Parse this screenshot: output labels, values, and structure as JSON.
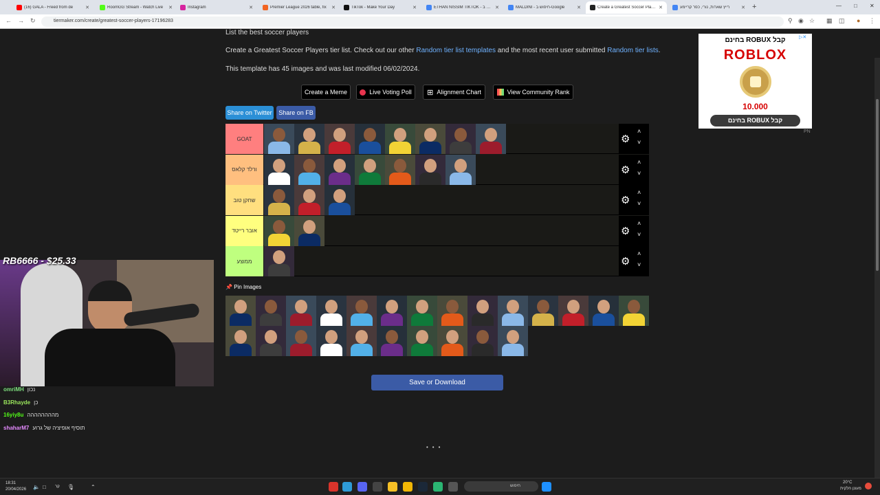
{
  "browser": {
    "tabs": [
      {
        "title": "(16) GALA - Freed from de",
        "color": "#ff0000",
        "active": false
      },
      {
        "title": "RoomGG Stream - Watch Live",
        "color": "#53fc18",
        "active": false
      },
      {
        "title": "Instagram",
        "color": "#d6249f",
        "active": false
      },
      {
        "title": "Premier League 2026 table, fix",
        "color": "#f26522",
        "active": false
      },
      {
        "title": "TikTok - Make Your Day",
        "color": "#111111",
        "active": false
      },
      {
        "title": "ETHAN NISSIM TIKTOK - חיפוש ב",
        "color": "#4285f4",
        "active": false
      },
      {
        "title": "MALDINI - חיפוש ב-Google",
        "color": "#4285f4",
        "active": false
      },
      {
        "title": "Create a Greatest Soccer Player",
        "color": "#222222",
        "active": true
      },
      {
        "title": "רייץ שארות, נורי, כפר קריימע",
        "color": "#4285f4",
        "active": false
      }
    ],
    "new_tab": "+",
    "url": "tiermaker.com/create/greatest-soccer-players-17196283"
  },
  "page": {
    "top_line": "List the best soccer players",
    "intro_pre": "Create a Greatest Soccer Players tier list. Check out our other ",
    "intro_link1": "Random tier list templates",
    "intro_mid": " and the most recent user submitted ",
    "intro_link2": "Random tier lists",
    "intro_post": ".",
    "template_info": "This template has 45 images and was last modified 06/02/2024.",
    "buttons": {
      "meme": "Create a Meme",
      "poll": "Live Voting Poll",
      "alignment": "Alignment Chart",
      "community": "View Community Rank"
    },
    "share_twitter": "Share on Twitter",
    "share_fb": "Share on FB",
    "pin_label": "Pin Images",
    "save": "Save or Download",
    "loading": "•••"
  },
  "tiers": [
    {
      "label": "GOAT",
      "color": "#ff7f7f",
      "count": 8
    },
    {
      "label": "ורלד קלאס",
      "color": "#ffbf7f",
      "count": 7
    },
    {
      "label": "שחקן טוב",
      "color": "#ffdf7f",
      "count": 3
    },
    {
      "label": "אובר רייטד",
      "color": "#ffff7f",
      "count": 2
    },
    {
      "label": "ממוצע",
      "color": "#bfff7f",
      "count": 1
    }
  ],
  "pool_count": 24,
  "ad": {
    "header": "בחינם ROBUX קבל",
    "logo": "ROBLOX",
    "amount": "10.000",
    "button": "בחינם ROBUX קבל",
    "tag": "PN"
  },
  "stream": {
    "overlay": "RB6666 - $25.33",
    "chat": [
      {
        "user": "omriMH",
        "text": "נכון",
        "color": "#7fe07f"
      },
      {
        "user": "B3Rhayde",
        "text": "כן",
        "color": "#9ae65c"
      },
      {
        "user": "16yiy8u",
        "text": "מהההההההה",
        "color": "#53fc18"
      },
      {
        "user": "shaharM7",
        "text": "תוסיף אופיציה של גרוע",
        "color": "#e58bff"
      }
    ]
  },
  "taskbar": {
    "time": "18:31",
    "date": "20/04/2026",
    "search": "חיפוש",
    "weather": "20°C",
    "weather_desc": "מעונן חלקית",
    "volume": "קר"
  }
}
